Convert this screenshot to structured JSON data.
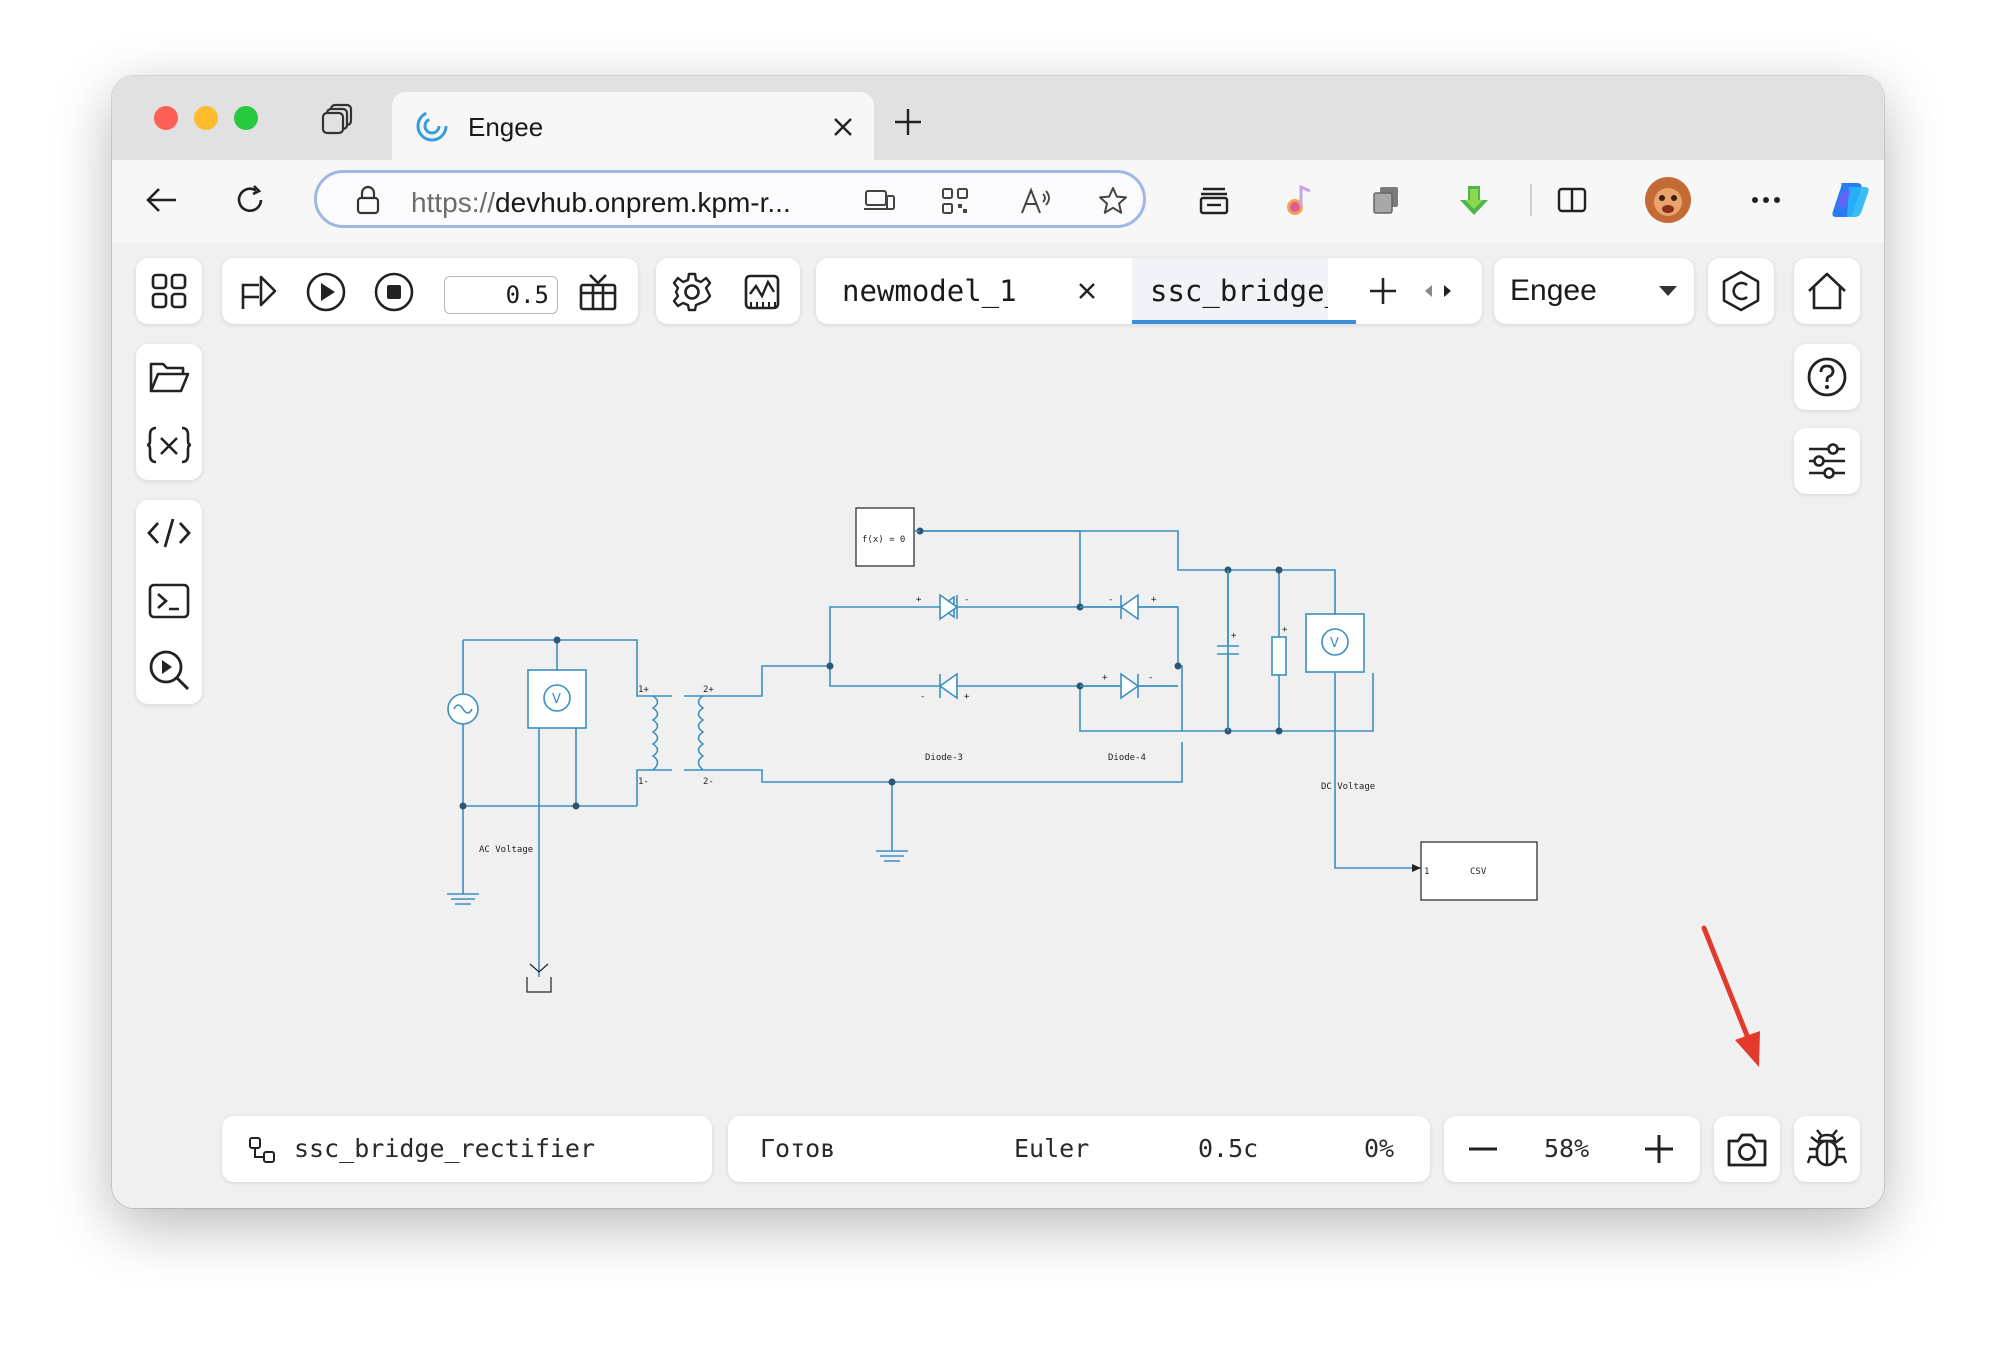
{
  "browser": {
    "tab_title": "Engee",
    "url_protocol": "https://",
    "url_rest": "devhub.onprem.kpm-r...",
    "colors": {
      "traffic_red": "#ff5f57",
      "traffic_yellow": "#febc2e",
      "traffic_green": "#28c840"
    }
  },
  "toolbar": {
    "stop_time": "0.5",
    "model_tabs": [
      {
        "label": "newmodel_1 *"
      },
      {
        "label": "ssc_bridge_"
      }
    ],
    "environment_select": "Engee"
  },
  "statusbar": {
    "model_name": "ssc_bridge_rectifier",
    "state": "Готов",
    "solver": "Euler",
    "sim_time": "0.5с",
    "progress": "0%",
    "zoom": "58%"
  },
  "diagram": {
    "labels": {
      "fx_block": "f(x) = 0",
      "ac_voltage": "AC Voltage",
      "dc_voltage": "DC Voltage",
      "diode3": "Diode-3",
      "diode4": "Diode-4",
      "csv": "CSV",
      "port_1p": "1+",
      "port_1m": "1-",
      "port_2p": "2+",
      "port_2m": "2-",
      "plus": "+",
      "minus": "-",
      "sensor_v": "V",
      "csv_in": "1"
    },
    "colors": {
      "wire": "#3c8fc0",
      "node": "#2d5673",
      "block_border": "#222222"
    }
  },
  "annotation": {
    "arrow_color": "#e23b2e"
  }
}
